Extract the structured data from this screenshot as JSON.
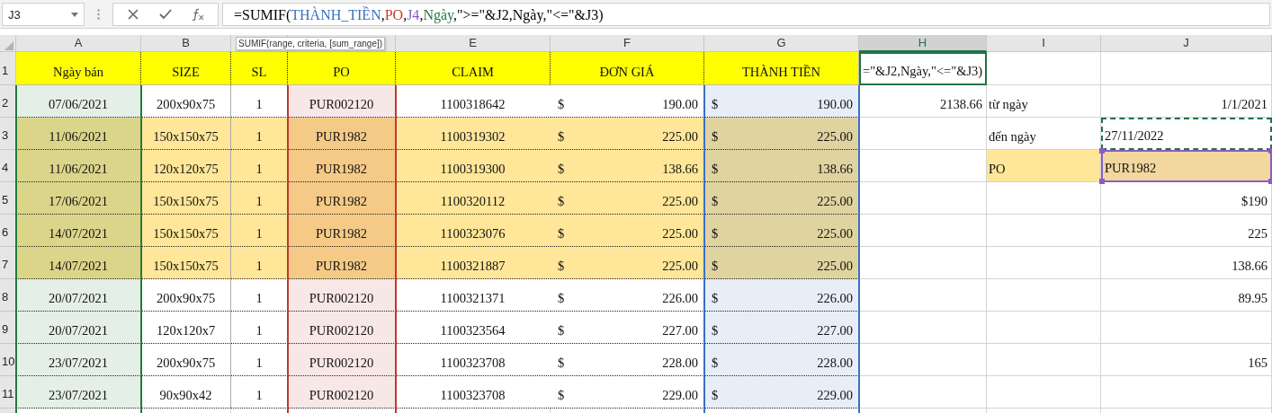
{
  "name_box": "J3",
  "formula_bar": {
    "segments": [
      {
        "text": "=SUMIF("
      },
      {
        "text": "THÀNH_TIỀN",
        "color": "#3a6fc4"
      },
      {
        "text": ","
      },
      {
        "text": "PO",
        "color": "#c0392b"
      },
      {
        "text": ","
      },
      {
        "text": "J4",
        "color": "#8a5cc4"
      },
      {
        "text": ","
      },
      {
        "text": "Ngày",
        "color": "#217a3c"
      },
      {
        "text": ",\">=\"&J2,Ngày,\"<=\"&J3)"
      }
    ]
  },
  "tooltip": "SUMIF(range, criteria, [sum_range])",
  "columns": [
    {
      "letter": "A",
      "selected": false,
      "color": "#217a3c"
    },
    {
      "letter": "B",
      "selected": false
    },
    {
      "selected": false
    },
    {
      "selected": false,
      "color": "#c0392b"
    },
    {
      "letter": "E",
      "selected": false
    },
    {
      "letter": "F",
      "selected": false
    },
    {
      "letter": "G",
      "selected": false,
      "color": "#3a6fc4"
    },
    {
      "letter": "H",
      "selected": true
    },
    {
      "letter": "I",
      "selected": false
    },
    {
      "letter": "J",
      "selected": false
    }
  ],
  "header_row": {
    "number": "1",
    "headers": [
      "Ngày bán",
      "SIZE",
      "SL",
      "PO",
      "CLAIM",
      "ĐƠN GIÁ",
      "THÀNH TIỀN"
    ],
    "side": {
      "h": {
        "text": "=\"&J2,Ngày,\"<=\"&J3)",
        "kind": "editing"
      }
    }
  },
  "rows": [
    {
      "number": "2",
      "highlighted": false,
      "cells": [
        "07/06/2021",
        "200x90x75",
        "1",
        "PUR002120",
        "1100318642"
      ],
      "price": {
        "currency": "$",
        "amount": "190.00"
      },
      "total": {
        "currency": "$",
        "amount": "190.00"
      },
      "side": {
        "h": {
          "text": "2138.66",
          "kind": "number"
        },
        "i": {
          "text": "từ ngày",
          "kind": "text"
        },
        "j": {
          "text": "1/1/2021",
          "kind": "number"
        }
      }
    },
    {
      "number": "3",
      "highlighted": true,
      "cells": [
        "11/06/2021",
        "150x150x75",
        "1",
        "PUR1982",
        "1100319302"
      ],
      "price": {
        "currency": "$",
        "amount": "225.00"
      },
      "total": {
        "currency": "$",
        "amount": "225.00"
      },
      "side": {
        "i": {
          "text": "đến ngày",
          "kind": "text"
        },
        "j": {
          "text": "27/11/2022",
          "kind": "marquee"
        }
      }
    },
    {
      "number": "4",
      "highlighted": true,
      "cells": [
        "11/06/2021",
        "120x120x75",
        "1",
        "PUR1982",
        "1100319300"
      ],
      "price": {
        "currency": "$",
        "amount": "138.66"
      },
      "total": {
        "currency": "$",
        "amount": "138.66"
      },
      "side": {
        "i": {
          "text": "PO",
          "kind": "filled"
        },
        "j": {
          "text": "PUR1982",
          "kind": "reference"
        }
      }
    },
    {
      "number": "5",
      "highlighted": true,
      "cells": [
        "17/06/2021",
        "150x150x75",
        "1",
        "PUR1982",
        "1100320112"
      ],
      "price": {
        "currency": "$",
        "amount": "225.00"
      },
      "total": {
        "currency": "$",
        "amount": "225.00"
      },
      "side": {
        "j": {
          "text": "$190",
          "kind": "number"
        }
      }
    },
    {
      "number": "6",
      "highlighted": true,
      "cells": [
        "14/07/2021",
        "150x150x75",
        "1",
        "PUR1982",
        "1100323076"
      ],
      "price": {
        "currency": "$",
        "amount": "225.00"
      },
      "total": {
        "currency": "$",
        "amount": "225.00"
      },
      "side": {
        "j": {
          "text": "225",
          "kind": "number"
        }
      }
    },
    {
      "number": "7",
      "highlighted": true,
      "cells": [
        "14/07/2021",
        "150x150x75",
        "1",
        "PUR1982",
        "1100321887"
      ],
      "price": {
        "currency": "$",
        "amount": "225.00"
      },
      "total": {
        "currency": "$",
        "amount": "225.00"
      },
      "side": {
        "j": {
          "text": "138.66",
          "kind": "number"
        }
      }
    },
    {
      "number": "8",
      "highlighted": false,
      "cells": [
        "20/07/2021",
        "200x90x75",
        "1",
        "PUR002120",
        "1100321371"
      ],
      "price": {
        "currency": "$",
        "amount": "226.00"
      },
      "total": {
        "currency": "$",
        "amount": "226.00"
      },
      "side": {
        "j": {
          "text": "89.95",
          "kind": "number"
        }
      }
    },
    {
      "number": "9",
      "highlighted": false,
      "cells": [
        "20/07/2021",
        "120x120x7",
        "1",
        "PUR002120",
        "1100323564"
      ],
      "price": {
        "currency": "$",
        "amount": "227.00"
      },
      "total": {
        "currency": "$",
        "amount": "227.00"
      },
      "side": {}
    },
    {
      "number": "10",
      "highlighted": false,
      "cells": [
        "23/07/2021",
        "200x90x75",
        "1",
        "PUR002120",
        "1100323708"
      ],
      "price": {
        "currency": "$",
        "amount": "228.00"
      },
      "total": {
        "currency": "$",
        "amount": "228.00"
      },
      "side": {
        "j": {
          "text": "165",
          "kind": "number"
        }
      }
    },
    {
      "number": "11",
      "highlighted": false,
      "cells": [
        "23/07/2021",
        "90x90x42",
        "1",
        "PUR002120",
        "1100323708"
      ],
      "price": {
        "currency": "$",
        "amount": "229.00"
      },
      "total": {
        "currency": "$",
        "amount": "229.00"
      },
      "side": {}
    }
  ]
}
